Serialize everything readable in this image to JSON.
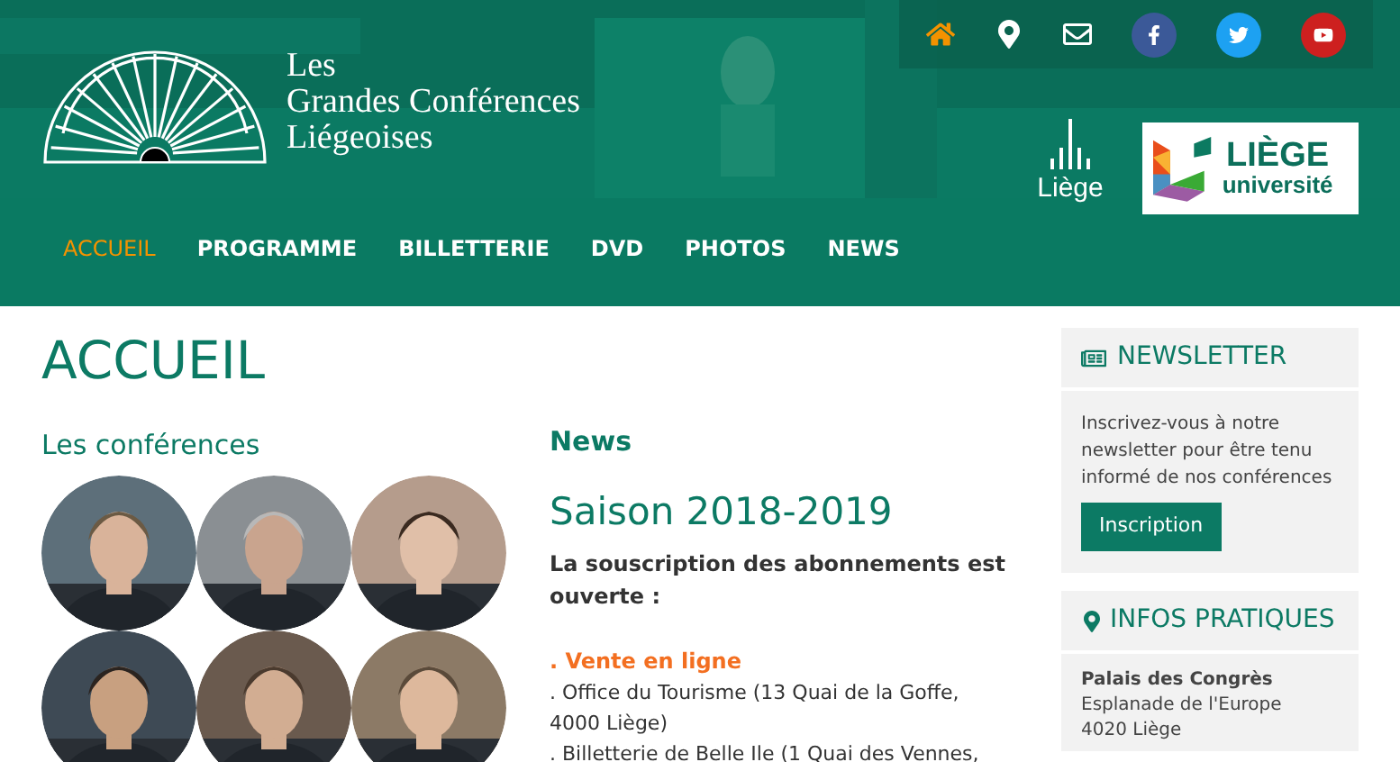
{
  "header": {
    "logo_lines": [
      "Les",
      "Grandes Conférences",
      "Liégeoises"
    ],
    "city_logo": "Liège",
    "university_logo": [
      "LIÈGE",
      "université"
    ]
  },
  "top_icons": [
    {
      "kind": "home",
      "selected": true
    },
    {
      "kind": "pin",
      "selected": false
    },
    {
      "kind": "mail",
      "selected": false
    },
    {
      "kind": "facebook",
      "selected": false
    },
    {
      "kind": "twitter",
      "selected": false
    },
    {
      "kind": "youtube",
      "selected": false
    }
  ],
  "nav": [
    {
      "label": "ACCUEIL",
      "selected": true
    },
    {
      "label": "PROGRAMME",
      "selected": false
    },
    {
      "label": "BILLETTERIE",
      "selected": false
    },
    {
      "label": "DVD",
      "selected": false
    },
    {
      "label": "PHOTOS",
      "selected": false
    },
    {
      "label": "NEWS",
      "selected": false
    }
  ],
  "page_title": "ACCUEIL",
  "conferences": {
    "heading": "Les conférences"
  },
  "news": {
    "heading": "News",
    "title": "Saison 2018-2019",
    "intro": "La souscription des abonnements est ouverte :",
    "items": [
      {
        "text": ". Vente en ligne",
        "kind": "link"
      },
      {
        "text": ". Office du Tourisme (13 Quai de la Goffe, 4000 Liège)",
        "kind": "plain"
      },
      {
        "text": ". Billetterie de Belle Ile (1 Quai des Vennes,",
        "kind": "plain"
      }
    ]
  },
  "newsletter": {
    "title": "NEWSLETTER",
    "text": "Inscrivez-vous à notre newsletter pour être tenu informé de nos conférences",
    "button": "Inscription"
  },
  "infos": {
    "title": "INFOS PRATIQUES",
    "venue": "Palais des Congrès",
    "lines": [
      "Esplanade de l'Europe",
      "4020 Liège"
    ]
  }
}
